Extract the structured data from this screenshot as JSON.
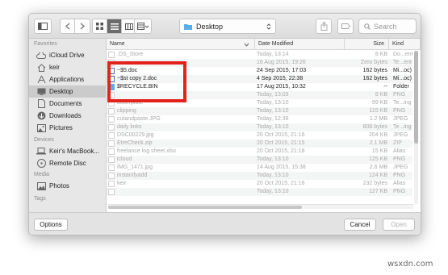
{
  "window": {
    "location": "Desktop",
    "search_placeholder": "Search"
  },
  "sidebar": {
    "sections": [
      {
        "label": "Favorites"
      },
      {
        "label": "Devices"
      },
      {
        "label": "Media"
      },
      {
        "label": "Tags"
      }
    ],
    "items": [
      {
        "label": "iCloud Drive",
        "icon": "cloud-icon"
      },
      {
        "label": "keir",
        "icon": "home-icon"
      },
      {
        "label": "Applications",
        "icon": "applications-icon"
      },
      {
        "label": "Desktop",
        "icon": "desktop-icon",
        "selected": true
      },
      {
        "label": "Documents",
        "icon": "documents-icon"
      },
      {
        "label": "Downloads",
        "icon": "downloads-icon"
      },
      {
        "label": "Pictures",
        "icon": "pictures-icon"
      },
      {
        "label": "Keir's MacBook...",
        "icon": "laptop-icon"
      },
      {
        "label": "Remote Disc",
        "icon": "disc-icon"
      },
      {
        "label": "Photos",
        "icon": "photos-icon"
      }
    ]
  },
  "columns": {
    "name": "Name",
    "date": "Date Modified",
    "size": "Size",
    "kind": "Kind"
  },
  "files": [
    {
      "name": ".DS_Store",
      "date": "Today, 13:14",
      "size": "8 KB",
      "kind": "Do...ent",
      "enabled": false
    },
    {
      "name": "",
      "date": "16 Aug 2015, 19:26",
      "size": "Zero bytes",
      "kind": "Te...ent",
      "enabled": false
    },
    {
      "name": "~$5.doc",
      "date": "24 Sep 2015, 17:03",
      "size": "162 bytes",
      "kind": "Mi...oc)",
      "enabled": true
    },
    {
      "name": "~$st copy 2.doc",
      "date": "4 Sep 2015, 22:38",
      "size": "162 bytes",
      "kind": "Mi...oc)",
      "enabled": true
    },
    {
      "name": "$RECYCLE.BIN",
      "date": "17 Aug 2015, 10:32",
      "size": "--",
      "kind": "Folder",
      "enabled": true
    },
    {
      "name": "",
      "date": "Today, 13:03",
      "size": "8 KB",
      "kind": "PNG",
      "enabled": false
    },
    {
      "name": "boilerplate",
      "date": "Today, 13:10",
      "size": "99 KB",
      "kind": "Te...ing",
      "enabled": false
    },
    {
      "name": "clipping",
      "date": "Today, 13:10",
      "size": "115 KB",
      "kind": "PNG",
      "enabled": false
    },
    {
      "name": "cutandpaste.JPG",
      "date": "Today, 12:39",
      "size": "1.2 MB",
      "kind": "JPEG",
      "enabled": false
    },
    {
      "name": "daily links",
      "date": "Today, 13:10",
      "size": "808 bytes",
      "kind": "Te...ing",
      "enabled": false
    },
    {
      "name": "DSC00229.jpg",
      "date": "20 Oct 2015, 21:16",
      "size": "204 KB",
      "kind": "JPEG",
      "enabled": false
    },
    {
      "name": "EtreCheck.zip",
      "date": "20 Oct 2015, 21:15",
      "size": "2.1 MB",
      "kind": "ZIP",
      "enabled": false
    },
    {
      "name": "freelance log sheet.xlsx",
      "date": "20 Oct 2015, 21:18",
      "size": "15 KB",
      "kind": "Alias",
      "enabled": false
    },
    {
      "name": "icloud",
      "date": "Today, 13:10",
      "size": "125 KB",
      "kind": "PNG",
      "enabled": false
    },
    {
      "name": "IMG_1471.jpg",
      "date": "14 Aug 2015, 15:38",
      "size": "2.6 MB",
      "kind": "JPEG",
      "enabled": false
    },
    {
      "name": "instantlyadd",
      "date": "Today, 13:10",
      "size": "124 KB",
      "kind": "PNG",
      "enabled": false
    },
    {
      "name": "keir",
      "date": "20 Oct 2015, 21:16",
      "size": "232 bytes",
      "kind": "Alias",
      "enabled": false
    },
    {
      "name": "",
      "date": "Today, 13:10",
      "size": "127 KB",
      "kind": "PNG",
      "enabled": false
    }
  ],
  "buttons": {
    "options": "Options",
    "cancel": "Cancel",
    "open": "Open"
  },
  "watermark": "wsxdn.com",
  "colors": {
    "highlight_box": "#e2231a",
    "selected_item": "#cbcbcb",
    "folder_blue": "#5aaef0"
  }
}
